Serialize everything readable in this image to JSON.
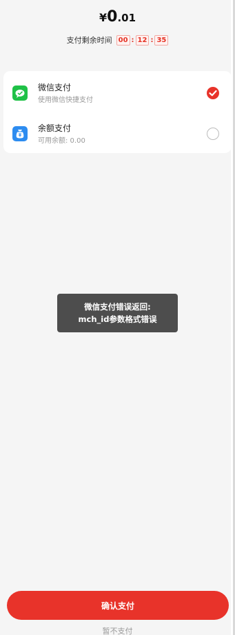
{
  "amount": {
    "symbol": "¥",
    "integer": "0",
    "decimal": ".01"
  },
  "countdown": {
    "label": "支付剩余时间",
    "hours": "00",
    "minutes": "12",
    "seconds": "35",
    "separator": ":"
  },
  "payment_methods": [
    {
      "title": "微信支付",
      "subtitle": "使用微信快捷支付",
      "icon": "wechat-pay-icon",
      "selected": true
    },
    {
      "title": "余额支付",
      "subtitle": "可用余额: 0.00",
      "icon": "wallet-icon",
      "selected": false
    }
  ],
  "toast": {
    "line1": "微信支付错误返回:",
    "line2": "mch_id参数格式错误"
  },
  "confirm_button": {
    "label": "确认支付"
  },
  "skip_link": {
    "label": "暂不支付"
  },
  "colors": {
    "accent": "#e8332a",
    "wechat_green": "#1fc147",
    "balance_blue": "#2d8cf0"
  }
}
